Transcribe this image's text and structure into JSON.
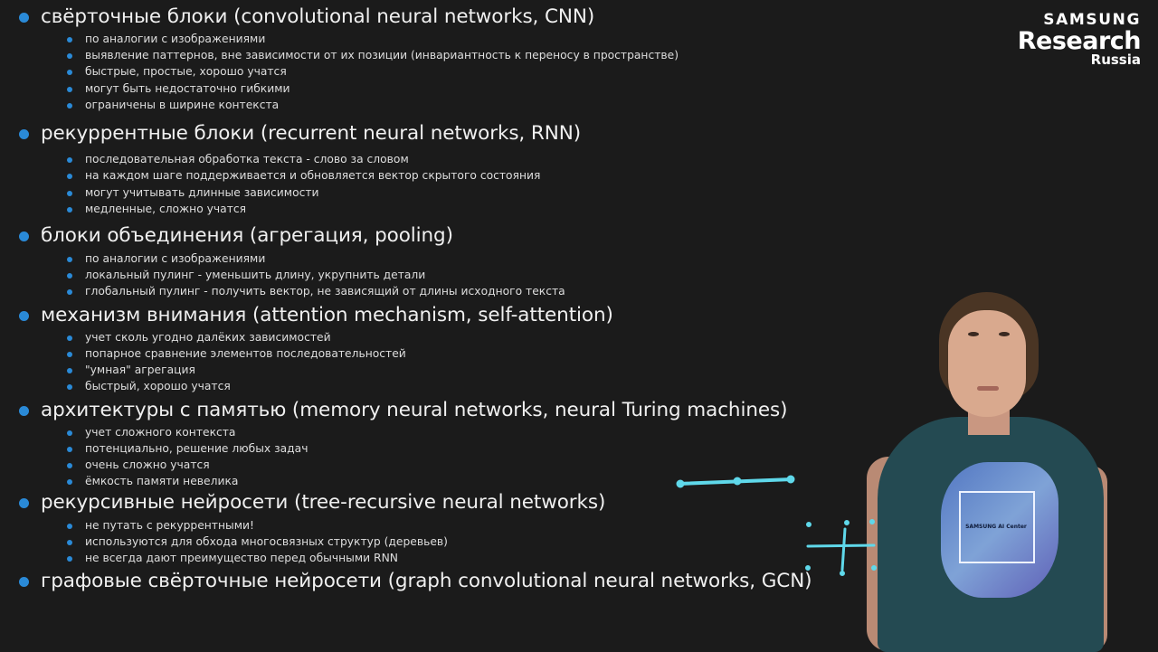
{
  "logo": {
    "brand": "SAMSUNG",
    "line2": "Research",
    "line3": "Russia"
  },
  "colors": {
    "background": "#1b1b1b",
    "bullet": "#2a8ad7",
    "ink": "#5fd8ea"
  },
  "tshirt": {
    "label": "SAMSUNG AI Center"
  },
  "topics": [
    {
      "title": "свёрточные блоки (convolutional neural networks, CNN)",
      "items": [
        "по аналогии с изображениями",
        "выявление паттернов, вне зависимости от их позиции (инвариантность к переносу в пространстве)",
        "быстрые, простые, хорошо учатся",
        "могут быть недостаточно гибкими",
        "ограничены в ширине контекста"
      ]
    },
    {
      "title": "рекуррентные блоки (recurrent neural networks, RNN)",
      "items": [
        "последовательная обработка текста - слово за словом",
        "на каждом шаге поддерживается и обновляется вектор скрытого состояния",
        "могут учитывать длинные зависимости",
        "медленные, сложно учатся"
      ]
    },
    {
      "title": "блоки объединения (агрегация, pooling)",
      "items": [
        "по аналогии с изображениями",
        "локальный пулинг - уменьшить длину, укрупнить детали",
        "глобальный пулинг - получить вектор, не зависящий от длины исходного текста"
      ]
    },
    {
      "title": "механизм внимания (attention mechanism, self-attention)",
      "items": [
        "учет сколь угодно далёких зависимостей",
        "попарное сравнение элементов последовательностей",
        "\"умная\" агрегация",
        "быстрый, хорошо учатся"
      ]
    },
    {
      "title": "архитектуры с памятью (memory neural networks, neural Turing machines)",
      "items": [
        "учет сложного контекста",
        "потенциально, решение любых задач",
        "очень сложно учатся",
        "ёмкость памяти невелика"
      ]
    },
    {
      "title": "рекурсивные нейросети (tree-recursive neural networks)",
      "items": [
        "не путать с рекуррентными!",
        "используются для обхода многосвязных структур (деревьев)",
        "не всегда дают преимущество перед обычными RNN"
      ]
    },
    {
      "title": "графовые свёрточные нейросети (graph convolutional neural networks, GCN)",
      "items": []
    }
  ]
}
